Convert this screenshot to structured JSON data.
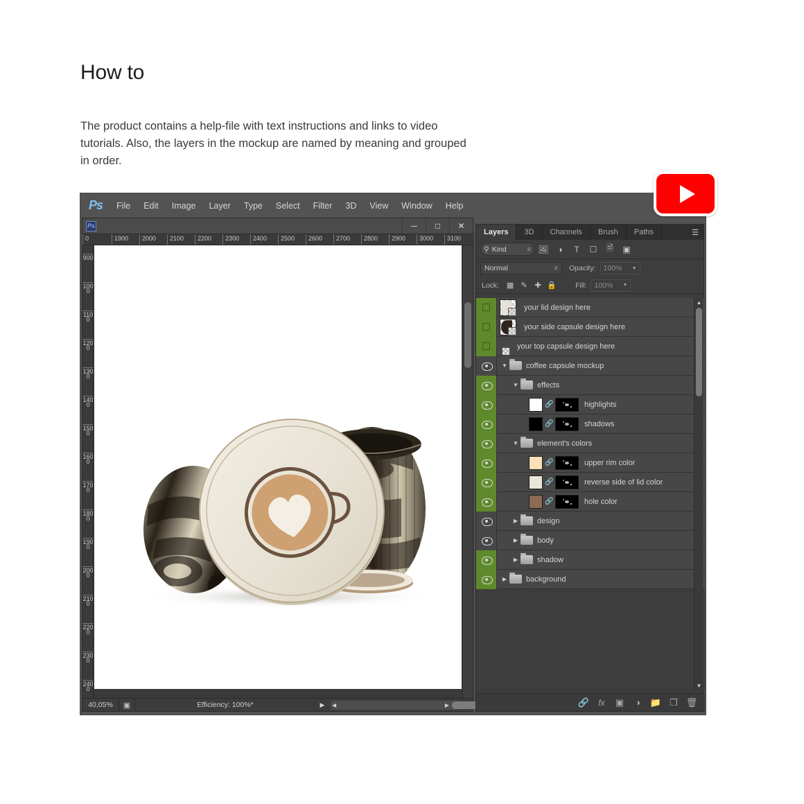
{
  "intro": {
    "heading": "How to",
    "body": "The product contains a help-file with text instructions and links to video tutorials. Also, the layers in the mockup are named by meaning and grouped in order."
  },
  "app": {
    "logo": "Ps",
    "menu": [
      "File",
      "Edit",
      "Image",
      "Layer",
      "Type",
      "Select",
      "Filter",
      "3D",
      "View",
      "Window",
      "Help"
    ]
  },
  "document": {
    "title": "",
    "window_buttons": [
      "minimize",
      "maximize",
      "close"
    ],
    "ruler_h_ticks": [
      "0",
      "1900",
      "2000",
      "2100",
      "2200",
      "2300",
      "2400",
      "2500",
      "2600",
      "2700",
      "2800",
      "2900",
      "3000",
      "3100"
    ],
    "ruler_v_ticks": [
      "900",
      "1000",
      "1100",
      "1200",
      "1300",
      "1400",
      "1500",
      "1600",
      "1700",
      "1800",
      "1900",
      "2000",
      "2100",
      "2200",
      "2300",
      "2400"
    ],
    "status": {
      "zoom": "40,05%",
      "efficiency": "Efficiency: 100%*"
    }
  },
  "layers_panel": {
    "tabs": [
      {
        "label": "Layers",
        "active": true
      },
      {
        "label": "3D",
        "active": false
      },
      {
        "label": "Channels",
        "active": false
      },
      {
        "label": "Brush",
        "active": false
      },
      {
        "label": "Paths",
        "active": false
      }
    ],
    "filter": {
      "kind_label": "Kind",
      "icons": [
        "pixel-layer-filter-icon",
        "adjustment-layer-filter-icon",
        "type-layer-filter-icon",
        "shape-layer-filter-icon",
        "smart-object-filter-icon",
        "filter-toggle-icon"
      ]
    },
    "blend_mode": "Normal",
    "opacity_label": "Opacity:",
    "opacity_value": "100%",
    "lock_label": "Lock:",
    "lock_icons": [
      "lock-transparent-pixels-icon",
      "lock-image-pixels-icon",
      "lock-position-icon",
      "lock-all-icon"
    ],
    "fill_label": "Fill:",
    "fill_value": "100%",
    "rows": [
      {
        "name": "your lid design here",
        "visible": false,
        "marked": true,
        "indent": 0,
        "type": "layer",
        "thumb": "art",
        "thumb_color": "#e6e2d8"
      },
      {
        "name": "your side capsule design here",
        "visible": false,
        "marked": true,
        "indent": 0,
        "type": "layer",
        "thumb": "art",
        "thumb_color": "#2e241a"
      },
      {
        "name": "your top capsule design here",
        "visible": false,
        "marked": true,
        "indent": 0,
        "type": "layer",
        "thumb": "empty",
        "thumb_color": "#ffffff"
      },
      {
        "name": "coffee capsule mockup",
        "visible": true,
        "marked": false,
        "indent": 0,
        "type": "group",
        "open": true
      },
      {
        "name": "effects",
        "visible": true,
        "marked": true,
        "indent": 1,
        "type": "group",
        "open": true
      },
      {
        "name": "highlights",
        "visible": true,
        "marked": true,
        "indent": 1,
        "type": "masked",
        "swatch": "#ffffff"
      },
      {
        "name": "shadows",
        "visible": true,
        "marked": true,
        "indent": 1,
        "type": "masked",
        "swatch": "#000000"
      },
      {
        "name": "element's colors",
        "visible": true,
        "marked": true,
        "indent": 1,
        "type": "group",
        "open": true
      },
      {
        "name": "upper rim color",
        "visible": true,
        "marked": true,
        "indent": 1,
        "type": "masked",
        "swatch": "#fadfb8"
      },
      {
        "name": "reverse side of lid color",
        "visible": true,
        "marked": true,
        "indent": 1,
        "type": "masked",
        "swatch": "#e9e6d8"
      },
      {
        "name": "hole color",
        "visible": true,
        "marked": true,
        "indent": 1,
        "type": "masked",
        "swatch": "#8d6a53"
      },
      {
        "name": "design",
        "visible": true,
        "marked": false,
        "indent": 1,
        "type": "group",
        "open": false
      },
      {
        "name": "body",
        "visible": true,
        "marked": false,
        "indent": 1,
        "type": "group",
        "open": false
      },
      {
        "name": "shadow",
        "visible": true,
        "marked": true,
        "indent": 1,
        "type": "group",
        "open": false
      },
      {
        "name": "background",
        "visible": true,
        "marked": true,
        "indent": 0,
        "type": "group",
        "open": false
      }
    ],
    "footer_icons": [
      "link-layers-icon",
      "layer-style-fx-icon",
      "add-layer-mask-icon",
      "adjustment-layer-icon",
      "new-group-icon",
      "new-layer-icon",
      "delete-layer-icon"
    ]
  },
  "youtube_badge": {
    "label": "youtube-play-icon"
  },
  "colors": {
    "panel_bg": "#3d3d3d",
    "row_bg": "#474747",
    "highlight_green": "#5f8a2b",
    "menu_bg": "#535353",
    "youtube_red": "#ff0000"
  }
}
